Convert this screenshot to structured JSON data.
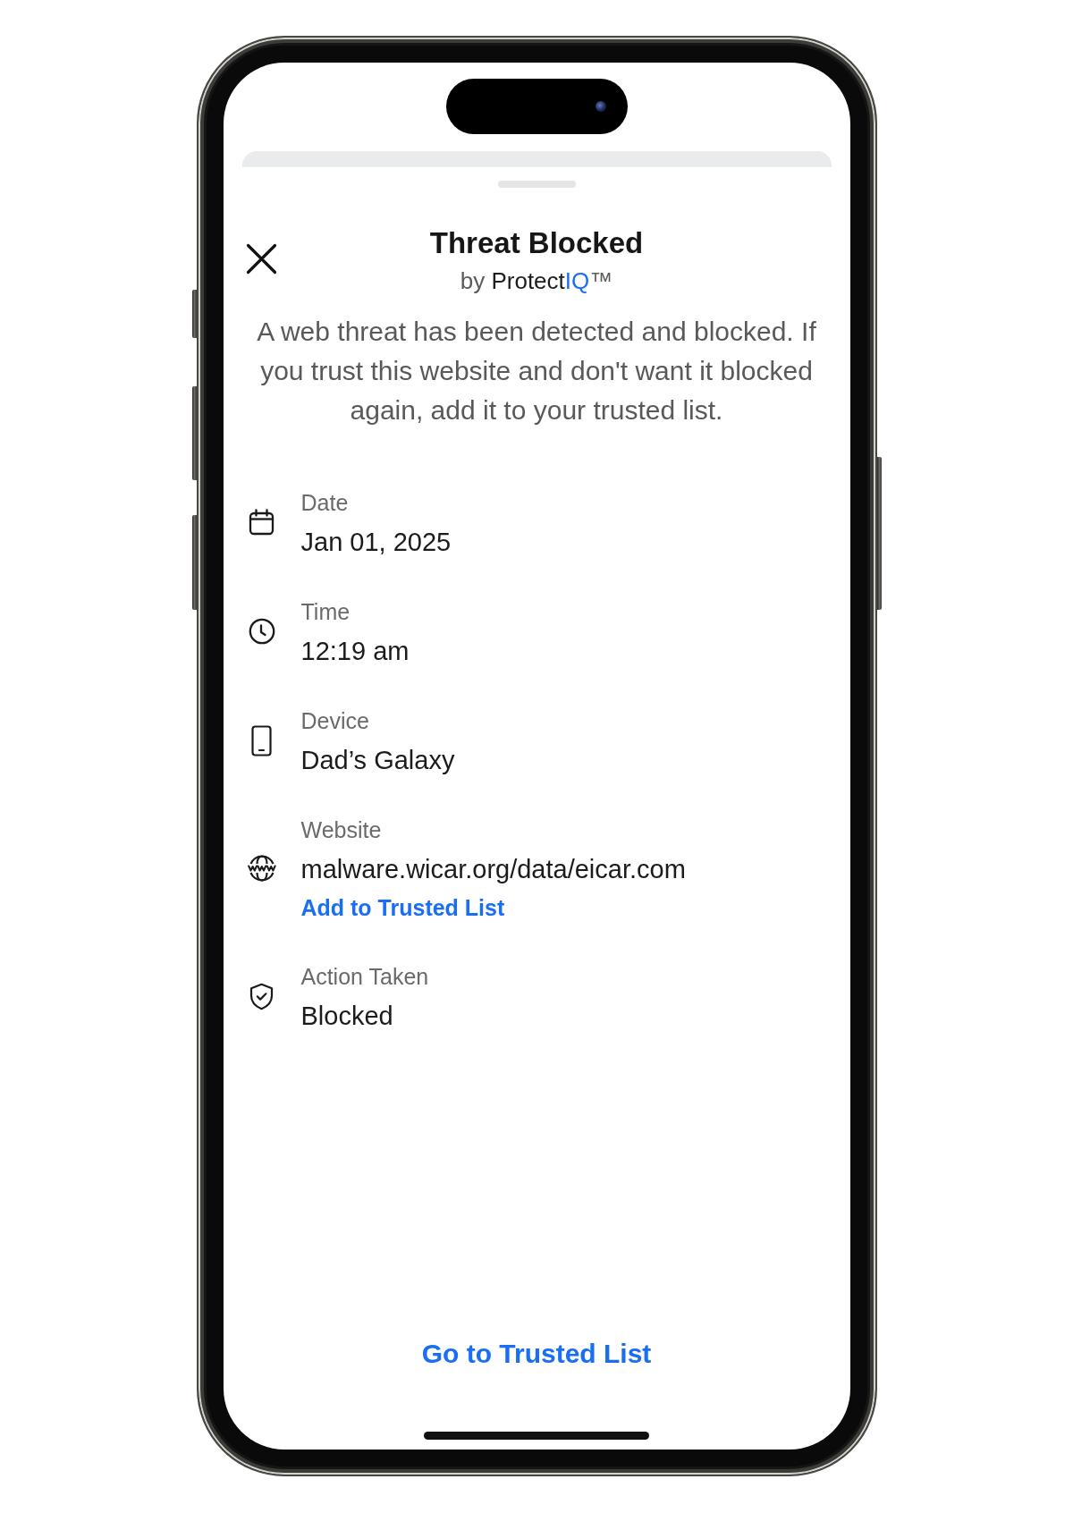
{
  "title": "Threat Blocked",
  "byline": {
    "prefix": "by",
    "brand": "Protect",
    "brand_accent": "IQ",
    "trademark": "™"
  },
  "message": "A web threat has been detected and blocked. If you trust this website and don't want it blocked again, add it to your trusted list.",
  "details": [
    {
      "kind": "date",
      "label": "Date",
      "value": "Jan 01, 2025"
    },
    {
      "kind": "time",
      "label": "Time",
      "value": "12:19 am"
    },
    {
      "kind": "device",
      "label": "Device",
      "value": "Dad’s Galaxy"
    },
    {
      "kind": "website",
      "label": "Website",
      "value": "malware.wicar.org/data/eicar.com",
      "action": "Add to Trusted List"
    },
    {
      "kind": "action",
      "label": "Action Taken",
      "value": "Blocked"
    }
  ],
  "footer_link": "Go to Trusted List"
}
